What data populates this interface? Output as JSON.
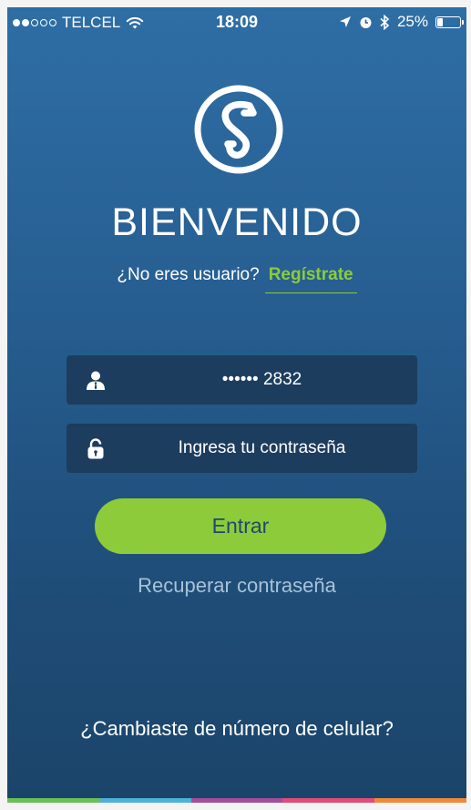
{
  "status_bar": {
    "carrier": "TELCEL",
    "time": "18:09",
    "battery": "25%",
    "battery_level": 0.25,
    "signal_bars_filled": 2,
    "signal_bars_total": 5
  },
  "welcome_title": "BIENVENIDO",
  "register": {
    "prompt": "¿No eres usuario?",
    "link": "Regístrate"
  },
  "phone_field": {
    "value": "•••••• 2832",
    "icon": "user-icon"
  },
  "password_field": {
    "placeholder": "Ingresa tu contraseña",
    "icon": "lock-icon"
  },
  "enter_button": "Entrar",
  "recover_link": "Recuperar contraseña",
  "change_number_link": "¿Cambiaste de número de celular?",
  "colors": {
    "accent_green": "#8dcb3b",
    "field_bg": "#1c3d5e",
    "strip": [
      "#6bbf5a",
      "#4fb1d6",
      "#a24f9c",
      "#e34b78",
      "#ef8a3c"
    ]
  }
}
